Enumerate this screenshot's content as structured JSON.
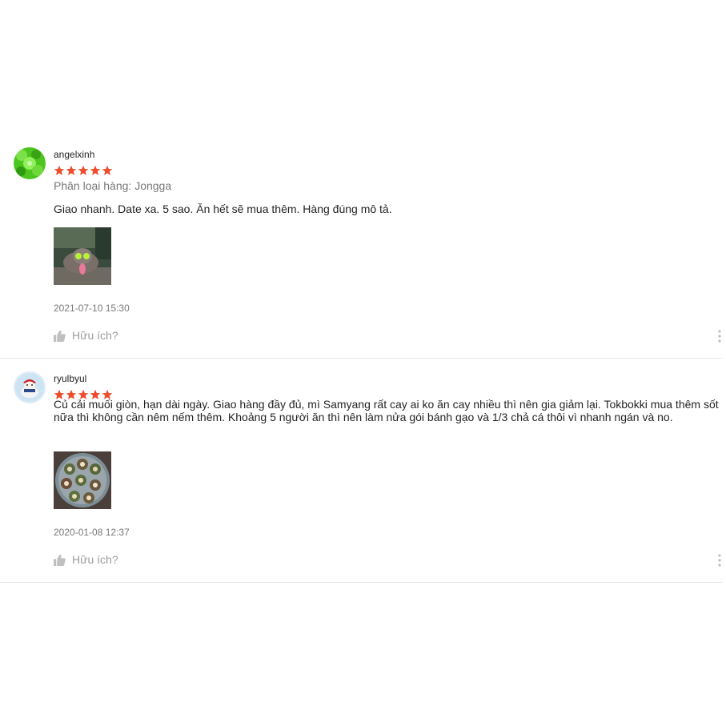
{
  "colors": {
    "star": "#ee4d2d",
    "divider": "#e5e5e5",
    "muted": "rgba(0,0,0,0.54)"
  },
  "reviews": [
    {
      "author": "angelxinh",
      "rating": 5,
      "variation": "Phân loại hàng: Jongga",
      "comment": "Giao nhanh. Date xa. 5 sao. Ăn hết sẽ mua thêm. Hàng đúng mô tả.",
      "time": "2021-07-10 15:30",
      "helpful_label": "Hữu ích?"
    },
    {
      "author": "ryulbyul",
      "rating": 5,
      "comment": "Củ cải muối giòn, hạn dài ngày. Giao hàng đầy đủ, mì Samyang rất cay ai ko ăn cay nhiều thì nên gia giảm lại. Tokbokki mua thêm sốt nữa thì không cần nêm nếm thêm. Khoảng 5 người ăn thì nên làm nửa gói bánh gạo và 1/3 chả cá thôi vì nhanh ngán và no.",
      "time": "2020-01-08 12:37",
      "helpful_label": "Hữu ích?"
    }
  ],
  "icons": {
    "like": "thumbs-up-icon",
    "more": "vertical-dots-icon",
    "star": "star-icon"
  }
}
